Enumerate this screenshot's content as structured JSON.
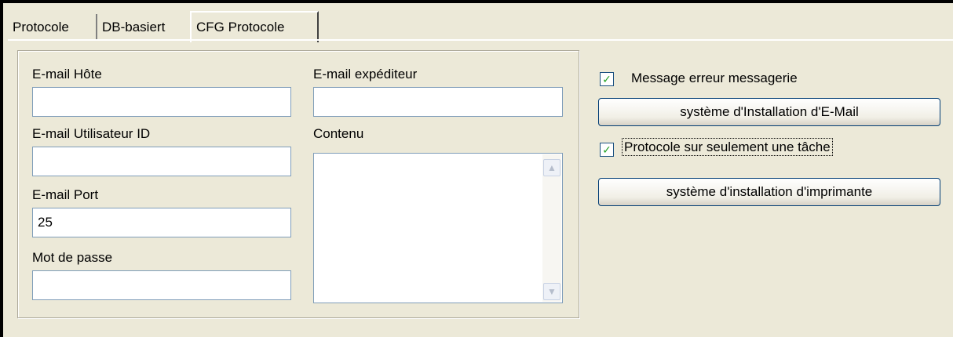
{
  "tabs": [
    {
      "label": "Protocole",
      "active": false
    },
    {
      "label": "DB-basiert",
      "active": false
    },
    {
      "label": "CFG Protocole",
      "active": true
    }
  ],
  "form": {
    "email_host_label": "E-mail Hôte",
    "email_host_value": "",
    "email_user_label": "E-mail Utilisateur ID",
    "email_user_value": "",
    "email_port_label": "E-mail Port",
    "email_port_value": "25",
    "password_label": "Mot de passe",
    "password_value": "",
    "sender_label": "E-mail expéditeur",
    "sender_value": "",
    "content_label": "Contenu",
    "content_value": ""
  },
  "options": {
    "mail_error_label": "Message erreur messagerie",
    "mail_error_checked": true,
    "email_setup_button": "système d'Installation d'E-Mail",
    "single_task_label": "Protocole sur seulement une tâche",
    "single_task_checked": true,
    "printer_setup_button": "système d'installation d'imprimante"
  },
  "icons": {
    "check": "checkmark-icon",
    "scroll_up": "scroll-up-arrow-icon",
    "scroll_down": "scroll-down-arrow-icon"
  },
  "colors": {
    "background": "#ece9d8",
    "input_border": "#7f9db9",
    "check_mark": "#21a121",
    "button_border": "#003c74"
  }
}
